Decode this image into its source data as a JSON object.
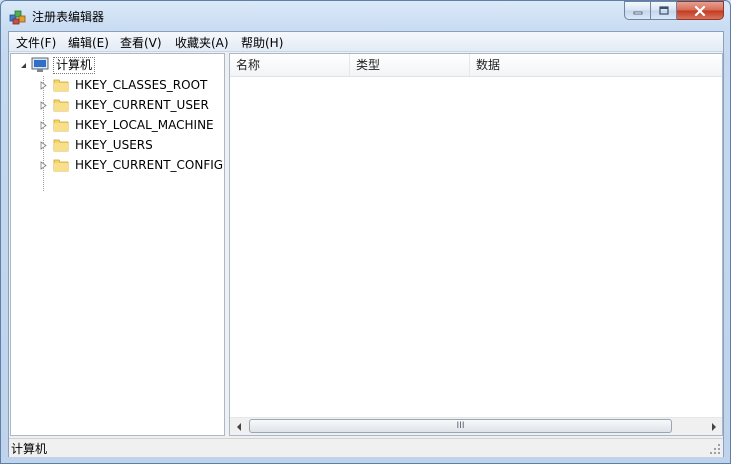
{
  "window": {
    "title": "注册表编辑器",
    "icon": "regedit-icon"
  },
  "menu": [
    {
      "label": "文件(F)"
    },
    {
      "label": "编辑(E)"
    },
    {
      "label": "查看(V)"
    },
    {
      "label": "收藏夹(A)"
    },
    {
      "label": "帮助(H)"
    }
  ],
  "tree": {
    "root": {
      "label": "计算机",
      "icon": "computer-icon",
      "expanded": true
    },
    "children": [
      {
        "label": "HKEY_CLASSES_ROOT",
        "icon": "folder-icon"
      },
      {
        "label": "HKEY_CURRENT_USER",
        "icon": "folder-icon"
      },
      {
        "label": "HKEY_LOCAL_MACHINE",
        "icon": "folder-icon"
      },
      {
        "label": "HKEY_USERS",
        "icon": "folder-icon"
      },
      {
        "label": "HKEY_CURRENT_CONFIG",
        "icon": "folder-icon"
      }
    ]
  },
  "list": {
    "columns": [
      {
        "label": "名称"
      },
      {
        "label": "类型"
      },
      {
        "label": "数据"
      }
    ],
    "scrollbar_grip": "III"
  },
  "status": {
    "text": "计算机"
  },
  "colors": {
    "folder": "#f5d469",
    "accent": "#5f7fa8",
    "close": "#c2391f"
  }
}
